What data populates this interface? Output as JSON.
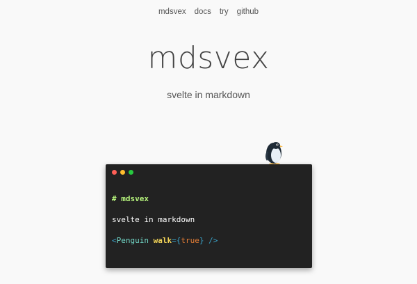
{
  "nav": {
    "items": [
      "mdsvex",
      "docs",
      "try",
      "github"
    ]
  },
  "hero": {
    "title": "mdsvex",
    "subtitle": "svelte in markdown"
  },
  "editor": {
    "window_dots": [
      "close",
      "minimize",
      "maximize"
    ],
    "heading_line": "# mdsvex",
    "text_line": "svelte in markdown",
    "component_line": {
      "open_bracket": "<",
      "tag": "Penguin",
      "space": " ",
      "attr": "walk",
      "eq": "=",
      "open_brace": "{",
      "value": "true",
      "close_brace": "}",
      "close": " />"
    }
  },
  "mascot": "penguin-icon",
  "colors": {
    "background": "#f9f9f9",
    "editor_background": "#222222",
    "heading_green": "#b7f57d",
    "tag_cyan": "#73d9c9",
    "attr_yellow": "#f2d357",
    "value_orange": "#e27c35",
    "dot_red": "#ff5f56",
    "dot_yellow": "#ffbd2e",
    "dot_green": "#27c93f"
  }
}
